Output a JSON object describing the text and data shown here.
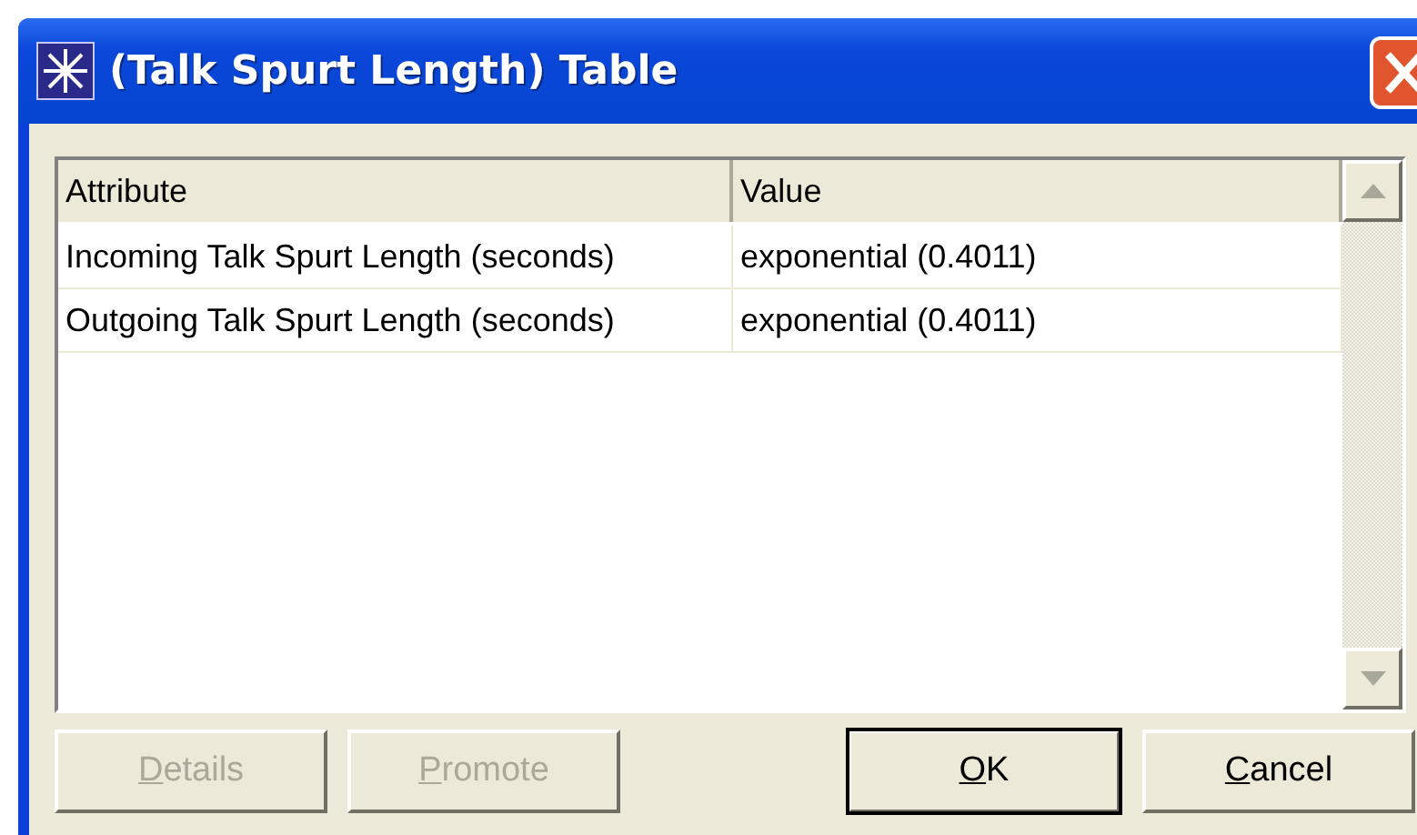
{
  "window": {
    "title": "(Talk Spurt Length) Table"
  },
  "table": {
    "columns": [
      "Attribute",
      "Value"
    ],
    "rows": [
      {
        "attribute": "Incoming Talk Spurt Length (seconds)",
        "value": "exponential (0.4011)"
      },
      {
        "attribute": "Outgoing Talk Spurt Length (seconds)",
        "value": "exponential (0.4011)"
      }
    ]
  },
  "buttons": [
    {
      "label": "Details",
      "disabled": true,
      "default": false
    },
    {
      "label": "Promote",
      "disabled": true,
      "default": false
    },
    {
      "label": "OK",
      "disabled": false,
      "default": true
    },
    {
      "label": "Cancel",
      "disabled": false,
      "default": false
    }
  ]
}
